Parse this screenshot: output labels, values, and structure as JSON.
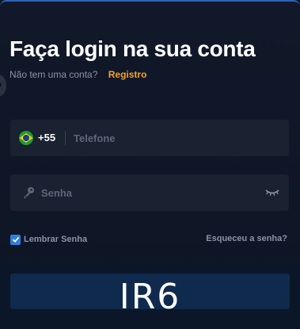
{
  "login": {
    "title": "Faça login na sua conta",
    "no_account_text": "Não tem uma conta?",
    "register_link": "Registro"
  },
  "phone_field": {
    "flag_icon": "brazil-flag-icon",
    "country_code": "+55",
    "placeholder": "Telefone",
    "value": ""
  },
  "password_field": {
    "leading_icon": "key-icon",
    "placeholder": "Senha",
    "value": "",
    "toggle_icon": "eye-closed-icon"
  },
  "remember": {
    "label": "Lembrar Senha",
    "checked": true
  },
  "forgot_link": "Esqueceu a senha?",
  "login_button": {
    "watermark": "IR6"
  },
  "colors": {
    "background": "#0f1626",
    "field_background": "#1a2130",
    "accent_link": "#f5a02a",
    "checkbox": "#2f7fe0",
    "button": "#0f2a4d",
    "top_border": "#2b66b8"
  }
}
